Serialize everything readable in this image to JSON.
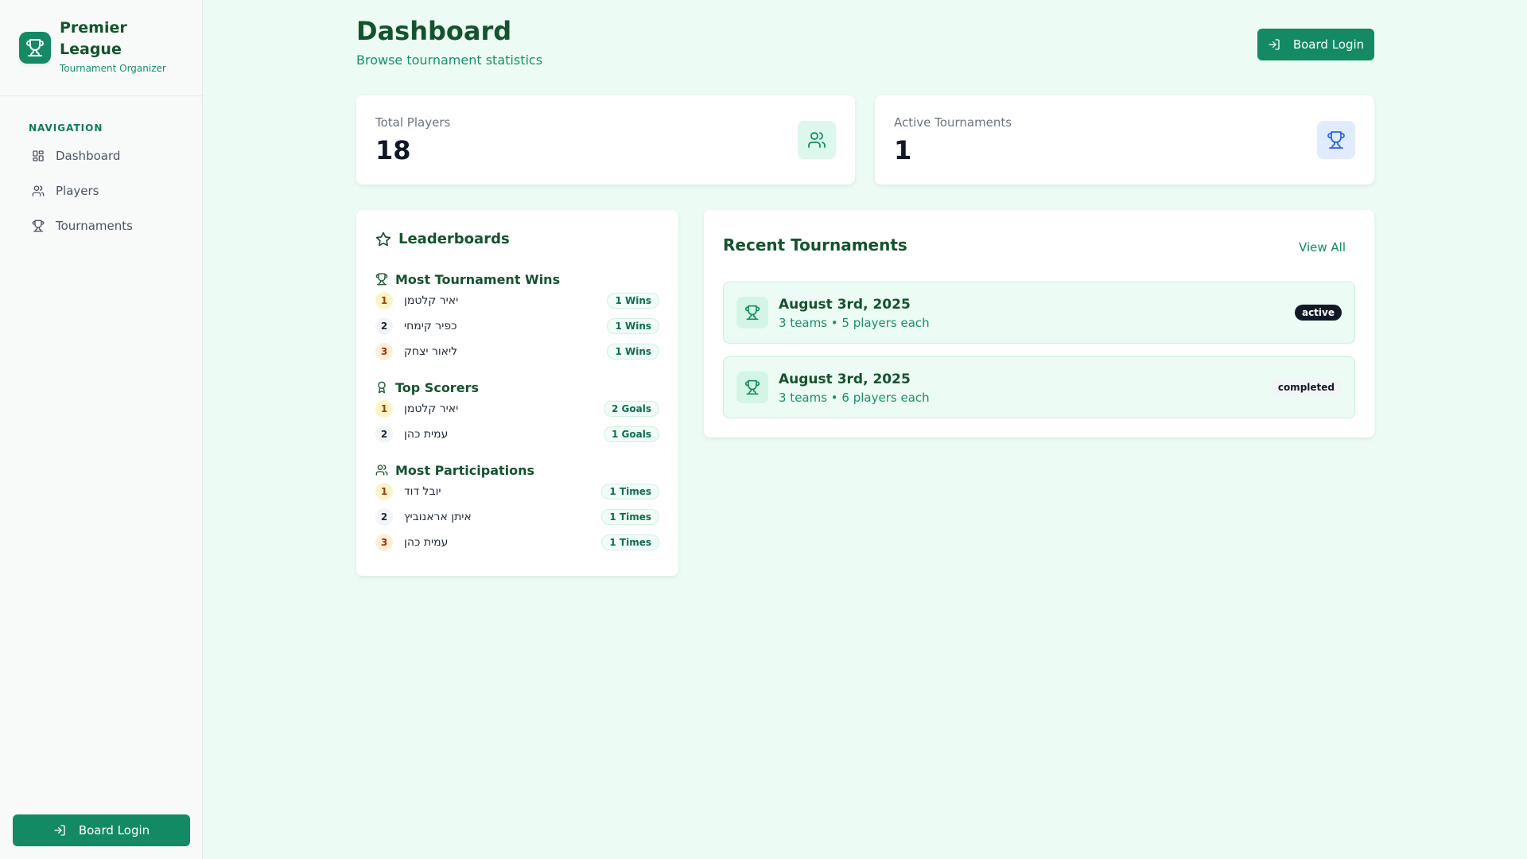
{
  "brand": {
    "title": "Premier League",
    "subtitle": "Tournament Organizer",
    "logo_icon": "trophy-icon"
  },
  "sidebar": {
    "heading": "NAVIGATION",
    "items": [
      {
        "label": "Dashboard",
        "icon": "grid-icon"
      },
      {
        "label": "Players",
        "icon": "users-icon"
      },
      {
        "label": "Tournaments",
        "icon": "trophy-icon"
      }
    ],
    "login_label": "Board Login"
  },
  "header": {
    "title": "Dashboard",
    "subtitle": "Browse tournament statistics",
    "login_label": "Board Login"
  },
  "stats": [
    {
      "label": "Total Players",
      "value": "18",
      "icon": "users-icon"
    },
    {
      "label": "Active Tournaments",
      "value": "1",
      "icon": "trophy-icon"
    }
  ],
  "leaderboards": {
    "title": "Leaderboards",
    "sections": [
      {
        "title": "Most Tournament Wins",
        "icon": "trophy-icon",
        "rows": [
          {
            "rank": "1",
            "name": "יאיר קלטמן",
            "value": "1 Wins"
          },
          {
            "rank": "2",
            "name": "כפיר קימחי",
            "value": "1 Wins"
          },
          {
            "rank": "3",
            "name": "ליאור יצחק",
            "value": "1 Wins"
          }
        ]
      },
      {
        "title": "Top Scorers",
        "icon": "award-icon",
        "rows": [
          {
            "rank": "1",
            "name": "יאיר קלטמן",
            "value": "2 Goals"
          },
          {
            "rank": "2",
            "name": "עמית כהן",
            "value": "1 Goals"
          }
        ]
      },
      {
        "title": "Most Participations",
        "icon": "users-icon",
        "rows": [
          {
            "rank": "1",
            "name": "יובל דוד",
            "value": "1 Times"
          },
          {
            "rank": "2",
            "name": "איתן אראנוביץ",
            "value": "1 Times"
          },
          {
            "rank": "3",
            "name": "עמית כהן",
            "value": "1 Times"
          }
        ]
      }
    ]
  },
  "recent": {
    "title": "Recent Tournaments",
    "view_all": "View All",
    "items": [
      {
        "date": "August 3rd, 2025",
        "meta": "3 teams • 5 players each",
        "status": "active"
      },
      {
        "date": "August 3rd, 2025",
        "meta": "3 teams • 6 players each",
        "status": "completed"
      }
    ]
  },
  "colors": {
    "brand": "#138a63",
    "heading": "#14532d",
    "background": "#ecfbf4"
  }
}
